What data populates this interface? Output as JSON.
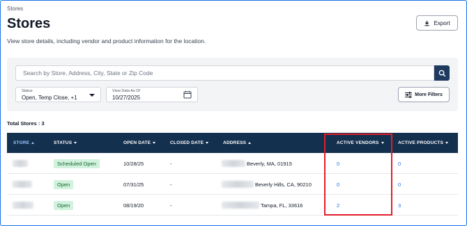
{
  "breadcrumb": "Stores",
  "page": {
    "title": "Stores",
    "subtitle": "View store details, including vendor and product information for the location."
  },
  "export_label": "Export",
  "search": {
    "placeholder": "Search by Store, Address, City, State or Zip Code"
  },
  "filters": {
    "status_label": "Status",
    "status_value": "Open, Temp Close, +1",
    "date_label": "View Data As Of",
    "date_value": "10/27/2025",
    "more_filters_label": "More Filters"
  },
  "total_stores": "Total Stores : 3",
  "table": {
    "columns": [
      "STORE",
      "STATUS",
      "OPEN DATE",
      "CLOSED DATE",
      "ADDRESS",
      "ACTIVE VENDORS",
      "ACTIVE PRODUCTS"
    ],
    "rows": [
      {
        "status": "Scheduled Open",
        "open_date": "10/28/25",
        "closed_date": "-",
        "address": "Beverly, MA, 01915",
        "active_vendors": "0",
        "active_products": "0"
      },
      {
        "status": "Open",
        "open_date": "07/31/25",
        "closed_date": "-",
        "address": "Beverly Hills, CA, 90210",
        "active_vendors": "0",
        "active_products": "0"
      },
      {
        "status": "Open",
        "open_date": "08/19/20",
        "closed_date": "-",
        "address": "Tampa, FL, 33616",
        "active_vendors": "2",
        "active_products": "3"
      }
    ]
  },
  "colors": {
    "header_bg": "#14304f",
    "link": "#1a73e8",
    "badge_bg": "#d1f2dd",
    "highlight": "#e11d2a"
  }
}
